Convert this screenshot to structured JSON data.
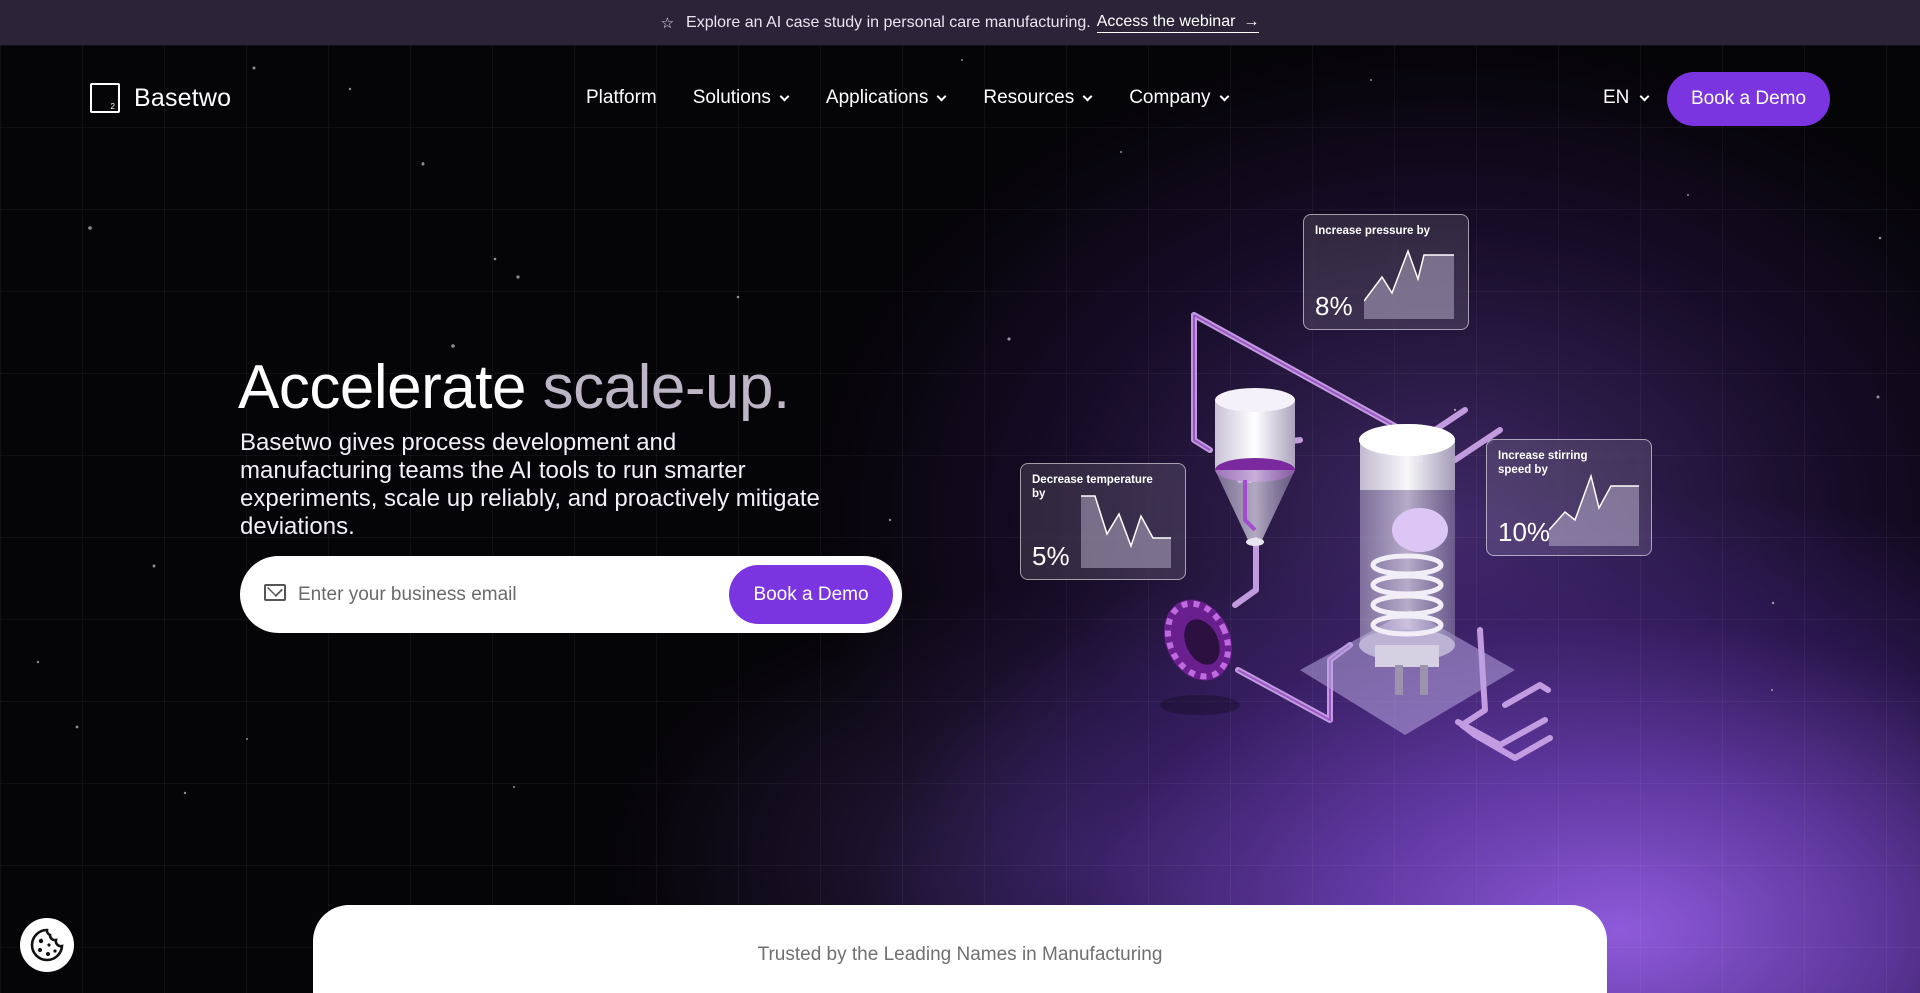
{
  "announcement": {
    "star_icon": "star-outline-icon",
    "text": "Explore an AI case study in personal care manufacturing.",
    "link_label": "Access the webinar",
    "arrow_icon": "arrow-right-icon"
  },
  "nav": {
    "logo_text": "Basetwo",
    "logo_subscript": "2",
    "items": [
      {
        "label": "Platform",
        "has_dropdown": false
      },
      {
        "label": "Solutions",
        "has_dropdown": true
      },
      {
        "label": "Applications",
        "has_dropdown": true
      },
      {
        "label": "Resources",
        "has_dropdown": true
      },
      {
        "label": "Company",
        "has_dropdown": true
      }
    ],
    "language": "EN",
    "cta_label": "Book a Demo"
  },
  "hero": {
    "title_main": "Accelerate",
    "title_muted": "scale-up.",
    "subtitle": "Basetwo gives process development and manufacturing teams the AI tools to run smarter experiments, scale up reliably, and proactively mitigate deviations.",
    "email_placeholder": "Enter your business email",
    "form_cta_label": "Book a Demo"
  },
  "illustration": {
    "cards": [
      {
        "label": "Increase pressure by",
        "value": "8%"
      },
      {
        "label": "Decrease temperature by",
        "value": "5%"
      },
      {
        "label": "Increase stirring speed by",
        "value": "10%"
      }
    ]
  },
  "trusted": {
    "text": "Trusted by the Leading Names in Manufacturing"
  },
  "cookie": {
    "icon": "cookie-icon"
  },
  "colors": {
    "accent": "#7a35e0",
    "announcement_bg": "#2b2438",
    "background": "#050407",
    "glow": "#9660e6"
  }
}
